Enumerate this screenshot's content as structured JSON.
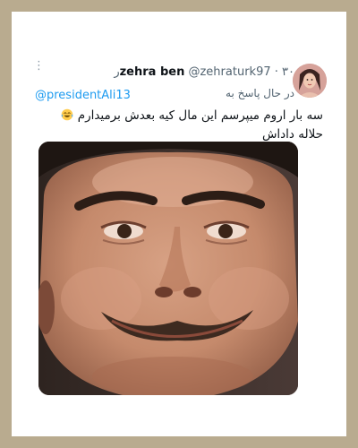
{
  "tweet": {
    "display_name": "zehra ben",
    "handle": "@zehraturk97",
    "separator": "·",
    "time": "۳۰ر",
    "reply_label": "در حال پاسخ به",
    "reply_to": "@presidentAli13",
    "body_before_emoji": "سه بار اروم میپرسم این مال کیه بعدش برمیدارم",
    "body_after_emoji": "حلاله داداش",
    "emoji": "laughing-crying-face",
    "more_icon": "more-vertical-icon"
  },
  "colors": {
    "frame": "#b9ab8f",
    "card": "#ffffff",
    "text": "#0f1419",
    "secondary": "#536471",
    "link": "#1d9bf0"
  }
}
